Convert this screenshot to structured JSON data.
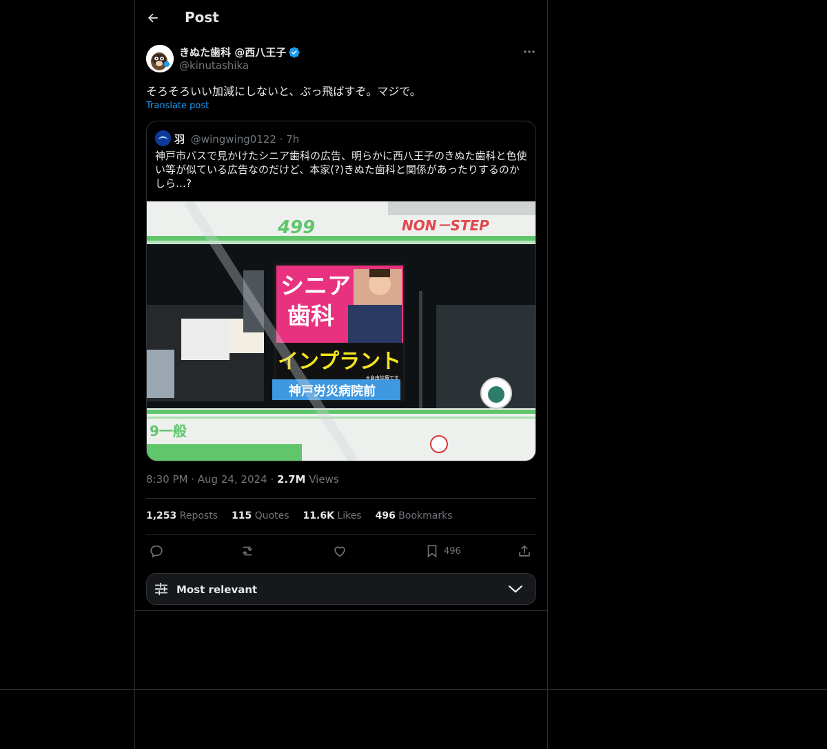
{
  "header": {
    "title": "Post"
  },
  "post": {
    "display_name": "きぬた歯科 @西八王子",
    "handle": "@kinutashika",
    "text": "そろそろいい加減にしないと、ぶっ飛ばすぞ。マジで。",
    "translate_label": "Translate post",
    "time": "8:30 PM",
    "date": "Aug 24, 2024",
    "views_count": "2.7M",
    "views_label": "Views"
  },
  "quote": {
    "name": "羽",
    "handle": "@wingwing0122",
    "age": "7h",
    "text": "神戸市バスで見かけたシニア歯科の広告、明らかに西八王子のきぬた歯科と色使い等が似ている広告なのだけど、本家(?)きぬた歯科と関係があったりするのかしら…?",
    "image": {
      "bus_number": "499",
      "bus_slogan": "NON－STEP",
      "ad_title_line1": "シニア",
      "ad_title_line2": "歯科",
      "ad_headline": "インプラント",
      "ad_note": "※自由診療です",
      "ad_stop": "神戸労災病院前",
      "route_mark": "9一般"
    }
  },
  "stats": {
    "reposts_count": "1,253",
    "reposts_label": "Reposts",
    "quotes_count": "115",
    "quotes_label": "Quotes",
    "likes_count": "11.6K",
    "likes_label": "Likes",
    "bookmarks_count": "496",
    "bookmarks_label": "Bookmarks"
  },
  "actions": {
    "bookmark_count": "496",
    "icons": [
      "reply-icon",
      "repost-icon",
      "like-icon",
      "bookmark-icon",
      "share-icon"
    ]
  },
  "sort": {
    "label": "Most relevant"
  },
  "colors": {
    "accent": "#1d9bf0",
    "background": "#000000",
    "border": "#2f3336",
    "muted": "#71767b",
    "text": "#e7e9ea"
  }
}
